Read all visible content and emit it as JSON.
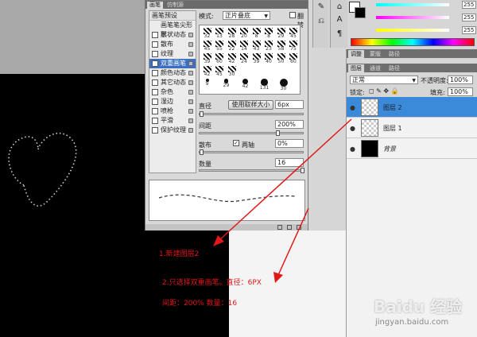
{
  "brush_panel": {
    "tabs": [
      "画笔",
      "仿制源"
    ],
    "presets_label": "画笔预设",
    "options": [
      {
        "label": "画笔笔尖形状",
        "checked": false,
        "selected": false
      },
      {
        "label": "形状动态",
        "checked": false,
        "selected": false
      },
      {
        "label": "散布",
        "checked": false,
        "selected": false
      },
      {
        "label": "纹理",
        "checked": false,
        "selected": false
      },
      {
        "label": "双重画笔",
        "checked": true,
        "selected": true
      },
      {
        "label": "颜色动态",
        "checked": false,
        "selected": false
      },
      {
        "label": "其它动态",
        "checked": false,
        "selected": false
      },
      {
        "label": "杂色",
        "checked": false,
        "selected": false
      },
      {
        "label": "湿边",
        "checked": false,
        "selected": false
      },
      {
        "label": "喷枪",
        "checked": false,
        "selected": false
      },
      {
        "label": "平滑",
        "checked": false,
        "selected": false
      },
      {
        "label": "保护纹理",
        "checked": false,
        "selected": false
      }
    ],
    "mode_label": "模式:",
    "mode_value": "正片叠底",
    "flip_label": "翻转",
    "brush_sizes": [
      "32",
      "13",
      "28",
      "20",
      "8",
      "8",
      "29",
      "45",
      "45",
      "55",
      "22",
      "14",
      "43",
      "23",
      "58",
      "75",
      "39",
      "60",
      "42",
      "24",
      "39",
      "40",
      "50",
      "60",
      "42",
      "45",
      "30"
    ],
    "bottom_sizes": [
      "9",
      "29",
      "42",
      "131",
      "30"
    ],
    "diameter_label": "直径",
    "use_sample_button": "使用取样大小",
    "diameter_value": "6px",
    "spacing_label": "间距",
    "spacing_value": "200%",
    "scatter_label": "散布",
    "both_axes_label": "两轴",
    "scatter_value": "0%",
    "count_label": "数量",
    "count_value": "16"
  },
  "color_panel": {
    "values": [
      "255",
      "255",
      "255"
    ]
  },
  "layers_panel": {
    "top_tabs": [
      "调整",
      "蒙版",
      "路径"
    ],
    "tabs": [
      "图层",
      "通道",
      "路径"
    ],
    "blend_mode": "正常",
    "opacity_label": "不透明度:",
    "opacity_value": "100%",
    "lock_label": "锁定:",
    "fill_label": "填充:",
    "fill_value": "100%",
    "layers": [
      {
        "name": "图层 2",
        "selected": true
      },
      {
        "name": "图层 1",
        "selected": false
      },
      {
        "name": "背景",
        "selected": false
      }
    ]
  },
  "annotations": {
    "step1": "1.新建图层2",
    "step2": "2.只选择双重画笔。直径：6PX",
    "step3": "间距：200%    数量：16"
  },
  "watermark": {
    "brand": "Baidu 经验",
    "url": "jingyan.baidu.com"
  },
  "colors": {
    "accent": "#3b89d9",
    "annotation": "#e01818"
  }
}
